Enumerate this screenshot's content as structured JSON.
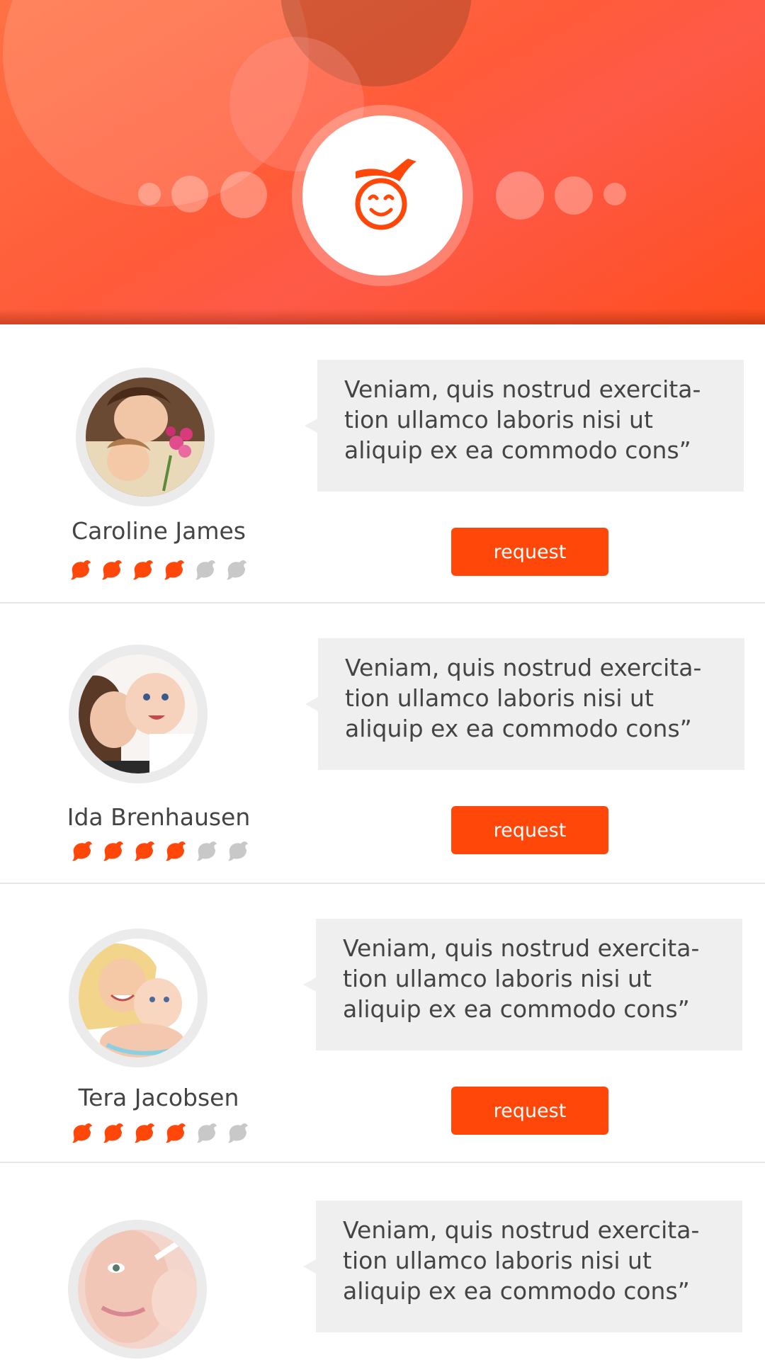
{
  "header": {
    "logo_icon": "smiling-face-logo-icon",
    "accent_color": "#ff470a"
  },
  "rating_icons": {
    "filled": "bird-filled-icon",
    "empty": "bird-empty-icon",
    "max": 6
  },
  "caregivers": [
    {
      "name": "Caroline James",
      "quote_lines": [
        "Veniam, quis nostrud exercita-",
        "tion ullamco laboris nisi ut",
        "aliquip ex ea commodo cons”"
      ],
      "button_label": "request",
      "rating": 4,
      "photo": "mother-and-daughter-with-flowers-photo"
    },
    {
      "name": "Ida Brenhausen",
      "quote_lines": [
        "Veniam, quis nostrud exercita-",
        "tion ullamco laboris nisi ut",
        "aliquip ex ea commodo cons”"
      ],
      "button_label": "request",
      "rating": 4,
      "photo": "mother-kissing-baby-photo"
    },
    {
      "name": "Tera Jacobsen",
      "quote_lines": [
        "Veniam, quis nostrud exercita-",
        "tion ullamco laboris nisi ut",
        "aliquip ex ea commodo cons”"
      ],
      "button_label": "request",
      "rating": 4,
      "photo": "blonde-mother-with-baby-photo"
    },
    {
      "name": "",
      "quote_lines": [
        "Veniam, quis nostrud exercita-",
        "tion ullamco laboris nisi ut",
        "aliquip ex ea commodo cons”"
      ],
      "photo": "mother-holding-baby-closeup-photo"
    }
  ]
}
